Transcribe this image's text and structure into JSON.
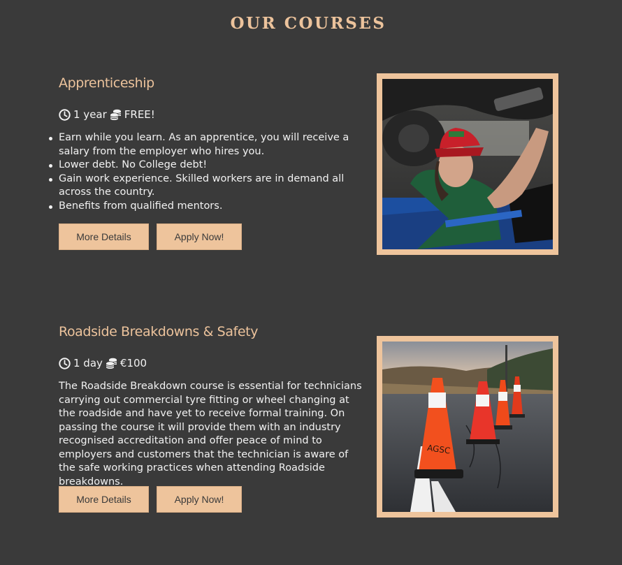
{
  "page": {
    "title": "OUR COURSES"
  },
  "courses": [
    {
      "title": "Apprenticeship",
      "duration": "1 year",
      "price": "FREE!",
      "bullets": [
        "Earn while you learn. As an apprentice, you will receive a salary from the employer who hires you.",
        "Lower debt. No College debt!",
        "Gain work experience. Skilled workers are in demand all across the country.",
        "Benefits from qualified mentors."
      ],
      "details_label": "More Details",
      "apply_label": "Apply Now!",
      "image_label": "apprentice-mechanic-photo"
    },
    {
      "title": "Roadside Breakdowns & Safety",
      "duration": "1 day",
      "price": "€100",
      "description": "The Roadside Breakdown course is essential for technicians carrying out commercial tyre fitting or wheel changing at the roadside and have yet to receive formal training. On passing the course it will provide them with an industry recognised accreditation and offer peace of mind to employers and customers that the technician is aware of the safe working practices when attending Roadside breakdowns.",
      "details_label": "More Details",
      "apply_label": "Apply Now!",
      "image_label": "traffic-cones-photo",
      "cone_text": "AGSC"
    }
  ],
  "icons": {
    "clock": "clock-icon",
    "coins": "coins-icon"
  },
  "colors": {
    "background": "#3a3a3a",
    "accent": "#ecc39c",
    "button": "#eec49c",
    "text": "#f2f2f2"
  }
}
